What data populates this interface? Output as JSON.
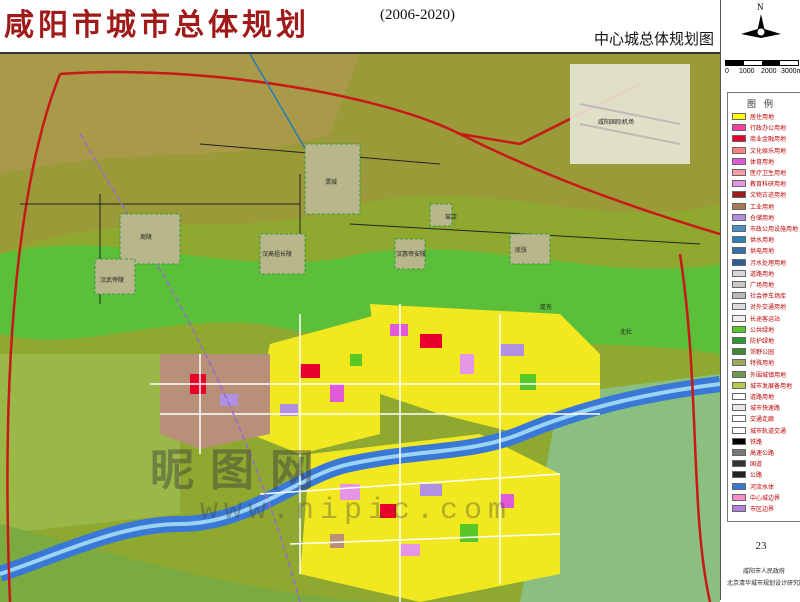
{
  "header": {
    "title": "咸阳市城市总体规划",
    "years": "(2006-2020)",
    "subtitle": "中心城总体规划图"
  },
  "compass": {
    "north_label": "N",
    "icon": "north-arrow-icon"
  },
  "scale": {
    "labels": [
      "0",
      "1000",
      "2000",
      "3000m"
    ]
  },
  "legend": {
    "title": "图例",
    "items": [
      {
        "label": "居住用地",
        "color": "#ffff00"
      },
      {
        "label": "行政办公用地",
        "color": "#ff3fa0"
      },
      {
        "label": "商业金融用地",
        "color": "#e8002a"
      },
      {
        "label": "文化娱乐用地",
        "color": "#ff8080"
      },
      {
        "label": "体育用地",
        "color": "#e05ad8"
      },
      {
        "label": "医疗卫生用地",
        "color": "#ff9aa8"
      },
      {
        "label": "教育科研用地",
        "color": "#e496e4"
      },
      {
        "label": "文物古迹用地",
        "color": "#9b1c1c"
      },
      {
        "label": "工业用地",
        "color": "#a8785a"
      },
      {
        "label": "仓储用地",
        "color": "#b090e0"
      },
      {
        "label": "市政公用设施用地",
        "color": "#4a8fc8"
      },
      {
        "label": "供水用地",
        "color": "#2f7fb8"
      },
      {
        "label": "供电用地",
        "color": "#3a6fa8"
      },
      {
        "label": "污水处理用地",
        "color": "#2a5f98"
      },
      {
        "label": "道路用地",
        "color": "#d8d8d8"
      },
      {
        "label": "广场用地",
        "color": "#c8c8c8"
      },
      {
        "label": "社会停车场库",
        "color": "#b8b8b8"
      },
      {
        "label": "对外交通用地",
        "color": "#dcdcdc"
      },
      {
        "label": "长途客运站",
        "color": "#f0f0f0"
      },
      {
        "label": "公共绿地",
        "color": "#58c828"
      },
      {
        "label": "防护绿地",
        "color": "#2a9a2a"
      },
      {
        "label": "郊野公园",
        "color": "#3a8a30"
      },
      {
        "label": "特殊用地",
        "color": "#9aaa5a"
      },
      {
        "label": "外围城镇用地",
        "color": "#6a9a4a"
      },
      {
        "label": "城市发展备用地",
        "color": "#b8c850"
      },
      {
        "label": "道路用地",
        "color": "#ffffff"
      },
      {
        "label": "城市快速路",
        "color": "#e8e8e8"
      },
      {
        "label": "交通走廊",
        "color": "#ffffff"
      },
      {
        "label": "城市轨道交通",
        "color": "#ffffff"
      },
      {
        "label": "铁路",
        "color": "#000000"
      },
      {
        "label": "高速公路",
        "color": "#777777"
      },
      {
        "label": "国道",
        "color": "#333333"
      },
      {
        "label": "公路",
        "color": "#222222"
      },
      {
        "label": "河流水体",
        "color": "#3a78d8"
      },
      {
        "label": "中心城边界",
        "color": "#ff8ac8"
      },
      {
        "label": "市区边界",
        "color": "#b080e0"
      }
    ]
  },
  "page_number": "23",
  "credits": [
    "咸阳市人民政府",
    "北京清华城市规划设计研究院"
  ],
  "map": {
    "labels": [
      "咸阳国际机场",
      "窑店",
      "渭城",
      "周陵",
      "汉武帝陵",
      "汉高祖长陵",
      "汉惠帝安陵",
      "底张",
      "庞东",
      "北杜"
    ]
  },
  "watermark": {
    "text": "昵图网",
    "url": "www.nipic.com"
  }
}
